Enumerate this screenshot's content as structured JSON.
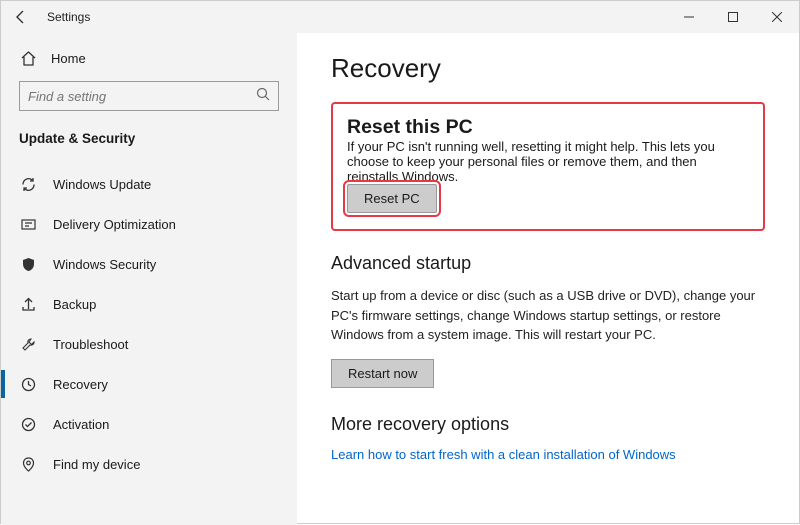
{
  "titlebar": {
    "app_title": "Settings"
  },
  "sidebar": {
    "home_label": "Home",
    "search_placeholder": "Find a setting",
    "category": "Update & Security",
    "items": [
      {
        "label": "Windows Update"
      },
      {
        "label": "Delivery Optimization"
      },
      {
        "label": "Windows Security"
      },
      {
        "label": "Backup"
      },
      {
        "label": "Troubleshoot"
      },
      {
        "label": "Recovery"
      },
      {
        "label": "Activation"
      },
      {
        "label": "Find my device"
      }
    ]
  },
  "main": {
    "title": "Recovery",
    "reset": {
      "heading": "Reset this PC",
      "body": "If your PC isn't running well, resetting it might help. This lets you choose to keep your personal files or remove them, and then reinstalls Windows.",
      "button": "Reset PC"
    },
    "advanced": {
      "heading": "Advanced startup",
      "body": "Start up from a device or disc (such as a USB drive or DVD), change your PC's firmware settings, change Windows startup settings, or restore Windows from a system image. This will restart your PC.",
      "button": "Restart now"
    },
    "more": {
      "heading": "More recovery options",
      "link": "Learn how to start fresh with a clean installation of Windows"
    }
  }
}
